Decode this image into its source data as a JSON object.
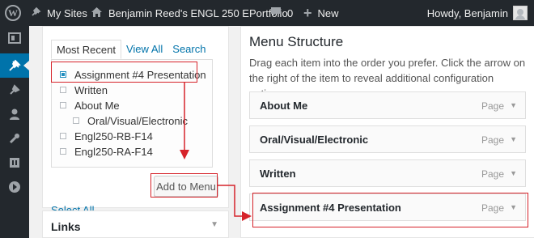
{
  "adminbar": {
    "wp_logo_icon": "wordpress-logo-icon",
    "my_sites": "My Sites",
    "site_name": "Benjamin Reed's ENGL 250 EPortfolio",
    "comments_count": "0",
    "new_label": "New",
    "howdy": "Howdy, Benjamin"
  },
  "adminmenu": {
    "items": [
      {
        "icon": "dashboard-icon"
      },
      {
        "icon": "pin-icon"
      },
      {
        "icon": "appearance-icon"
      },
      {
        "icon": "users-icon"
      },
      {
        "icon": "tools-icon"
      },
      {
        "icon": "settings-icon"
      },
      {
        "icon": "collapse-icon"
      }
    ]
  },
  "pages_box": {
    "tabs": [
      "Most Recent",
      "View All",
      "Search"
    ],
    "items": [
      {
        "label": "Assignment #4 Presentation",
        "checked": true
      },
      {
        "label": "Written",
        "checked": false
      },
      {
        "label": "About Me",
        "checked": false
      },
      {
        "label": "Oral/Visual/Electronic",
        "checked": false
      },
      {
        "label": "Engl250-RB-F14",
        "checked": false
      },
      {
        "label": "Engl250-RA-F14",
        "checked": false
      }
    ],
    "select_all": "Select All",
    "add_to_menu": "Add to Menu"
  },
  "links_box": {
    "title": "Links"
  },
  "menu_structure": {
    "heading": "Menu Structure",
    "instructions": "Drag each item into the order you prefer. Click the arrow on the right of the item to reveal additional configuration options.",
    "items": [
      {
        "title": "About Me",
        "type": "Page"
      },
      {
        "title": "Oral/Visual/Electronic",
        "type": "Page"
      },
      {
        "title": "Written",
        "type": "Page"
      },
      {
        "title": "Assignment #4 Presentation",
        "type": "Page"
      }
    ]
  },
  "colors": {
    "adminbar_bg": "#23282d",
    "accent": "#0073aa",
    "highlight": "#d6232a"
  }
}
